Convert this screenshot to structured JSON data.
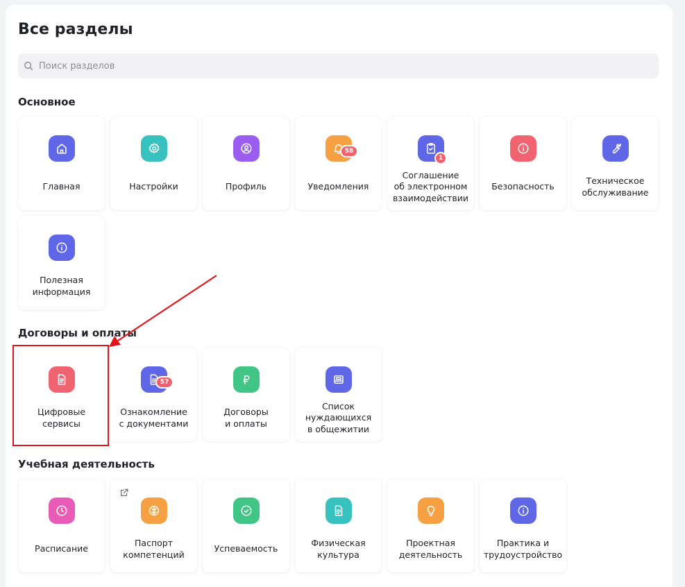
{
  "page": {
    "title": "Все разделы",
    "search_placeholder": "Поиск разделов"
  },
  "colors": {
    "indigo": "#6067e6",
    "teal": "#37c2c0",
    "purple": "#9b5cf0",
    "orange": "#f4a043",
    "red": "#ef6470",
    "green": "#41c586",
    "pink": "#e85bb6",
    "badge": "#f0616e",
    "annotation": "#e0141c"
  },
  "sections": [
    {
      "title": "Основное",
      "items": [
        {
          "label": "Главная",
          "icon": "home-icon"
        },
        {
          "label": "Настройки",
          "icon": "gear-icon"
        },
        {
          "label": "Профиль",
          "icon": "user-circle-icon"
        },
        {
          "label": "Уведомления",
          "icon": "bell-icon",
          "badge": "58"
        },
        {
          "label": "Соглашение\nоб электронном\nвзаимодействии",
          "icon": "clipboard-check-icon",
          "badge": "1"
        },
        {
          "label": "Безопасность",
          "icon": "info-icon"
        },
        {
          "label": "Техническое\nобслуживание",
          "icon": "wrench-icon"
        },
        {
          "label": "Полезная\nинформация",
          "icon": "info-icon"
        }
      ]
    },
    {
      "title": "Договоры и оплаты",
      "items": [
        {
          "label": "Цифровые\nсервисы",
          "icon": "document-icon"
        },
        {
          "label": "Ознакомление\nс документами",
          "icon": "document-icon",
          "badge": "57"
        },
        {
          "label": "Договоры\nи оплаты",
          "icon": "ruble-icon"
        },
        {
          "label": "Список\nнуждающихся\nв общежитии",
          "icon": "bed-icon"
        }
      ]
    },
    {
      "title": "Учебная деятельность",
      "items": [
        {
          "label": "Расписание",
          "icon": "clock-icon"
        },
        {
          "label": "Паспорт\nкомпетенций",
          "icon": "brain-icon",
          "external_icon": "external-link-icon"
        },
        {
          "label": "Успеваемость",
          "icon": "check-circle-icon"
        },
        {
          "label": "Физическая\nкультура",
          "icon": "document-icon"
        },
        {
          "label": "Проектная\nдеятельность",
          "icon": "lightbulb-icon"
        },
        {
          "label": "Практика и\nтрудоустройство",
          "icon": "info-icon"
        }
      ]
    }
  ]
}
